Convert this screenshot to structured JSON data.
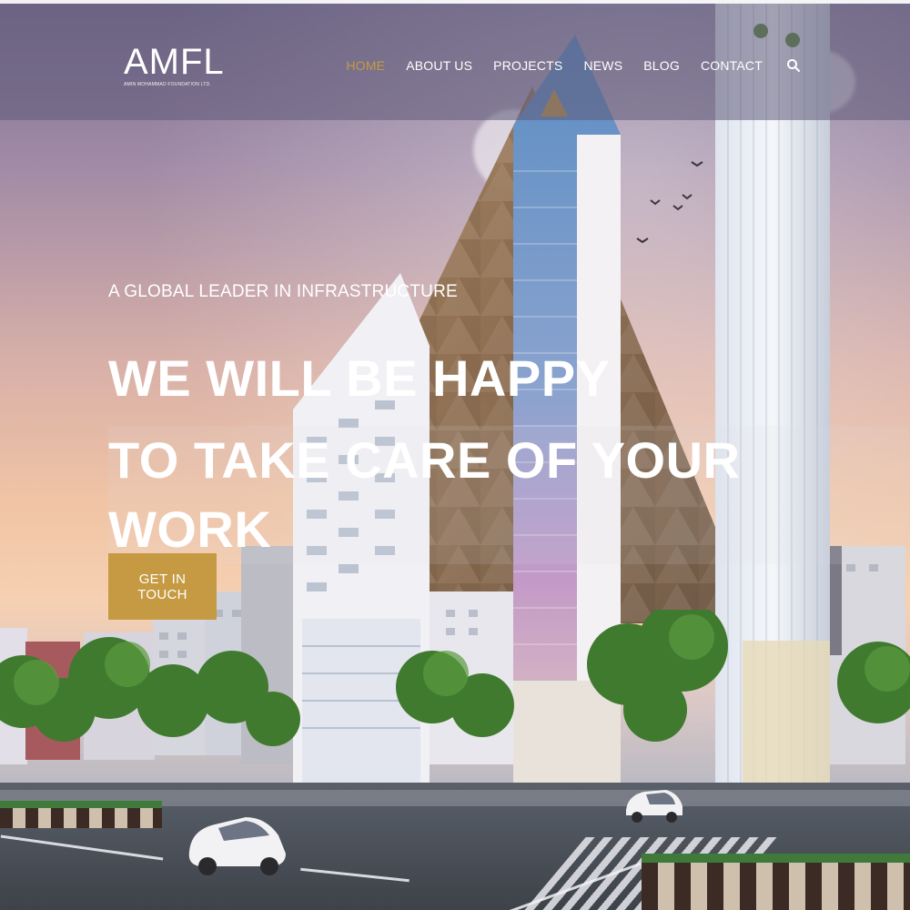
{
  "brand": {
    "logo_text": "AMFL",
    "logo_subtext": "AMIN MOHAMMAD FOUNDATION LTD."
  },
  "nav": {
    "items": [
      "HOME",
      "ABOUT US",
      "PROJECTS",
      "NEWS",
      "BLOG",
      "CONTACT"
    ],
    "active": "HOME",
    "search_icon": "search-icon"
  },
  "hero": {
    "eyebrow": "A GLOBAL LEADER IN INFRASTRUCTURE",
    "headline_line1": "WE WILL BE HAPPY",
    "headline_line2": "TO TAKE CARE OF YOUR WORK",
    "cta_label": "GET IN TOUCH"
  },
  "colors": {
    "accent": "#c59a42",
    "header_overlay": "rgba(95,90,120,0.55)",
    "text": "#ffffff"
  }
}
